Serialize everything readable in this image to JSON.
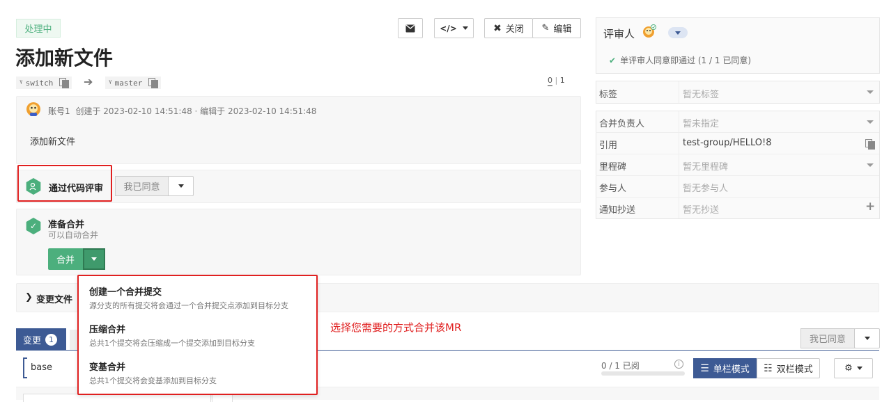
{
  "mr": {
    "status_badge": "处理中",
    "title": "添加新文件",
    "source_branch": "switch",
    "target_branch": "master",
    "commit_counter_left": "0",
    "commit_counter_right": "1",
    "author": "账号1",
    "created_text": "创建于 2023-02-10 14:51:48 · 编辑于 2023-02-10 14:51:48",
    "description": "添加新文件"
  },
  "toolbar": {
    "close_label": "关闭",
    "edit_label": "编辑"
  },
  "review": {
    "label": "通过代码评审",
    "approve_button": "我已同意"
  },
  "merge": {
    "title": "准备合并",
    "subtitle": "可以自动合并",
    "merge_button": "合并"
  },
  "merge_options": [
    {
      "title": "创建一个合并提交",
      "desc": "源分支的所有提交将会通过一个合并提交点添加到目标分支"
    },
    {
      "title": "压缩合并",
      "desc": "总共1个提交将会压缩成一个提交添加到目标分支"
    },
    {
      "title": "变基合并",
      "desc": "总共1个提交将会变基添加到目标分支"
    }
  ],
  "annotation": "选择您需要的方式合并该MR",
  "changes": {
    "section_label": "变更文件",
    "tab_label": "变更",
    "tab_count": "1",
    "base_label": "base",
    "approve_button": "我已同意",
    "read_progress": "0 / 1 已阅",
    "read_fraction": 0,
    "single_mode": "单栏模式",
    "double_mode": "双栏模式"
  },
  "sidebar": {
    "reviewer_label": "评审人",
    "reviewer_status": "单评审人同意即通过 (1 / 1 已同意)",
    "rows": [
      {
        "label": "标签",
        "value": "暂无标签"
      },
      {
        "label": "合并负责人",
        "value": "暂未指定"
      },
      {
        "label": "引用",
        "value": "test-group/HELLO!8"
      },
      {
        "label": "里程碑",
        "value": "暂无里程碑"
      },
      {
        "label": "参与人",
        "value": "暂无参与人"
      },
      {
        "label": "通知抄送",
        "value": "暂无抄送"
      }
    ]
  },
  "colors": {
    "accent_green": "#4caf7d",
    "annotation_red": "#e02020",
    "primary_blue": "#3d5a94"
  }
}
